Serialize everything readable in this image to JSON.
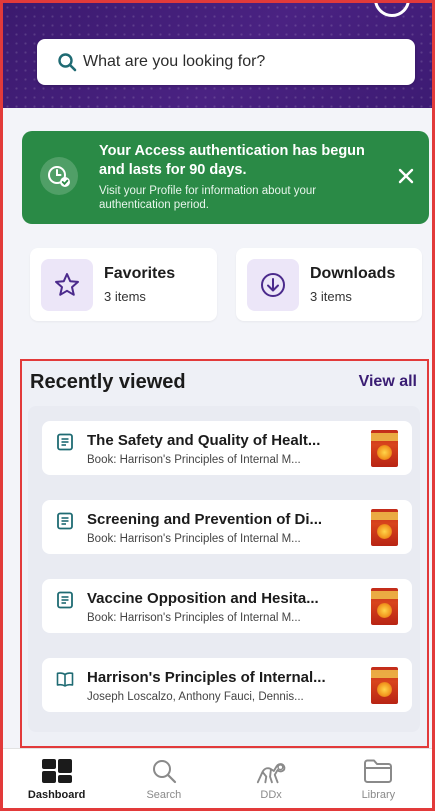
{
  "search": {
    "placeholder": "What are you looking for?"
  },
  "alert": {
    "title": "Your Access authentication has begun and lasts for 90 days.",
    "body": "Visit your Profile for information about your authentication period."
  },
  "quick_links": {
    "favorites": {
      "label": "Favorites",
      "count": "3 items"
    },
    "downloads": {
      "label": "Downloads",
      "count": "3 items"
    }
  },
  "recently_viewed": {
    "heading": "Recently viewed",
    "view_all": "View all",
    "items": [
      {
        "icon": "document-icon",
        "title": "The Safety and Quality of Healt...",
        "subtitle": "Book: Harrison's Principles of Internal M..."
      },
      {
        "icon": "document-icon",
        "title": "Screening and Prevention of Di...",
        "subtitle": "Book: Harrison's Principles of Internal M..."
      },
      {
        "icon": "document-icon",
        "title": "Vaccine Opposition and Hesita...",
        "subtitle": "Book: Harrison's Principles of Internal M..."
      },
      {
        "icon": "open-book-icon",
        "title": "Harrison's Principles of Internal...",
        "subtitle": "Joseph Loscalzo, Anthony Fauci, Dennis..."
      }
    ]
  },
  "nav": {
    "tabs": [
      {
        "label": "Dashboard",
        "icon": "dashboard-icon",
        "active": true
      },
      {
        "label": "Search",
        "icon": "search-icon",
        "active": false
      },
      {
        "label": "DDx",
        "icon": "ddx-icon",
        "active": false
      },
      {
        "label": "Library",
        "icon": "folder-icon",
        "active": false
      }
    ]
  },
  "colors": {
    "header": "#4a2282",
    "alert": "#2a8a46",
    "accent": "#3a1d73",
    "highlight_border": "#e23a3a"
  }
}
